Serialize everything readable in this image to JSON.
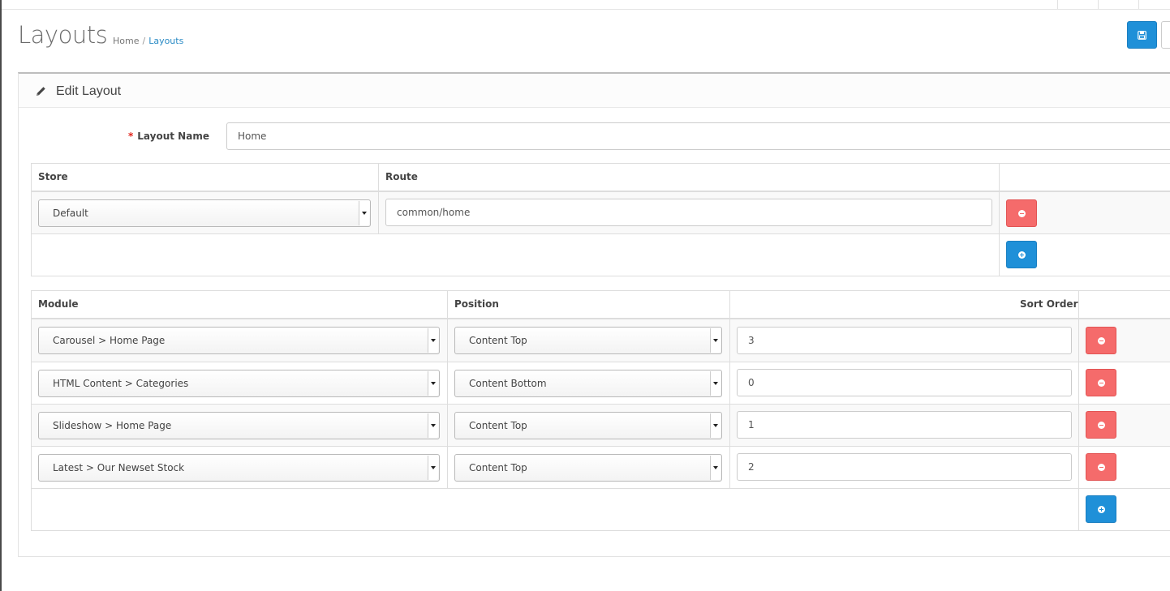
{
  "page": {
    "title": "Layouts"
  },
  "breadcrumb": {
    "home": "Home",
    "separator": "/",
    "current": "Layouts"
  },
  "toolbar": {
    "save_icon": "floppy-disk-icon",
    "back_icon": "reply-icon"
  },
  "panel": {
    "title": "Edit Layout",
    "icon": "pencil-icon"
  },
  "form": {
    "layout_name_label": "Layout Name",
    "required_mark": "*",
    "layout_name_value": "Home"
  },
  "routes": {
    "headers": {
      "store": "Store",
      "route": "Route"
    },
    "rows": [
      {
        "store": "Default",
        "route": "common/home"
      }
    ]
  },
  "modules": {
    "headers": {
      "module": "Module",
      "position": "Position",
      "sort_order": "Sort Order"
    },
    "rows": [
      {
        "module": "Carousel > Home Page",
        "position": "Content Top",
        "sort_order": "3"
      },
      {
        "module": "HTML Content > Categories",
        "position": "Content Bottom",
        "sort_order": "0"
      },
      {
        "module": "Slideshow > Home Page",
        "position": "Content Top",
        "sort_order": "1"
      },
      {
        "module": "Latest > Our Newset Stock",
        "position": "Content Top",
        "sort_order": "2"
      }
    ]
  },
  "colors": {
    "primary": "#1f90d8",
    "danger": "#f56b6b",
    "link": "#2a8bc5",
    "required": "#e2231a"
  }
}
